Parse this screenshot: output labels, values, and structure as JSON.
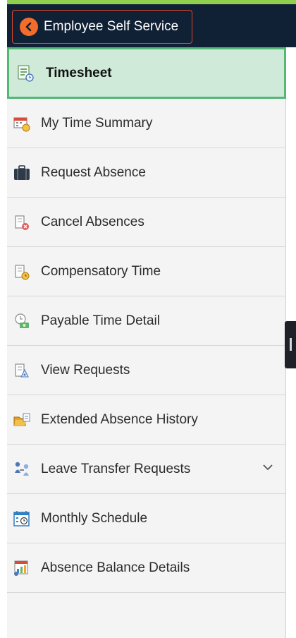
{
  "header": {
    "back_label": "Employee Self Service"
  },
  "nav": {
    "items": [
      {
        "label": "Timesheet",
        "icon": "timesheet-icon"
      },
      {
        "label": "My Time Summary",
        "icon": "time-summary-icon"
      },
      {
        "label": "Request Absence",
        "icon": "briefcase-icon"
      },
      {
        "label": "Cancel Absences",
        "icon": "cancel-absence-icon"
      },
      {
        "label": "Compensatory Time",
        "icon": "compensatory-time-icon"
      },
      {
        "label": "Payable Time Detail",
        "icon": "payable-time-icon"
      },
      {
        "label": "View Requests",
        "icon": "view-requests-icon"
      },
      {
        "label": "Extended Absence History",
        "icon": "folder-icon"
      },
      {
        "label": "Leave Transfer Requests",
        "icon": "people-transfer-icon"
      },
      {
        "label": "Monthly Schedule",
        "icon": "calendar-icon"
      },
      {
        "label": "Absence Balance Details",
        "icon": "bar-report-icon"
      }
    ]
  },
  "colors": {
    "header_bg": "#102035",
    "header_accent": "#8fd14f",
    "back_button_border": "#e04a2c",
    "back_circle": "#f36c2a",
    "active_bg": "#cfead8",
    "active_border": "#55b776"
  }
}
